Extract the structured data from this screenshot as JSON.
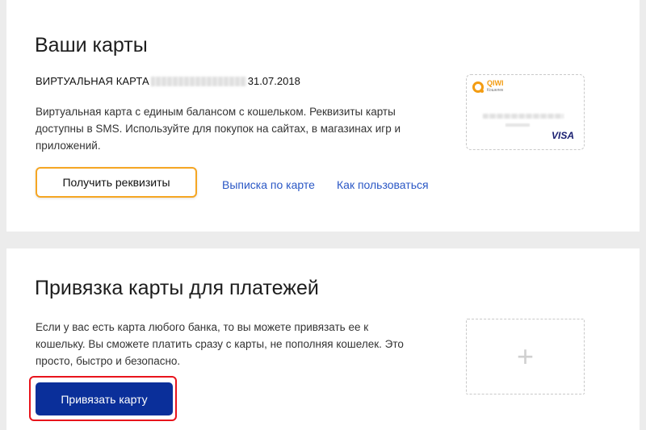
{
  "cards_section": {
    "title": "Ваши карты",
    "card_label": "ВИРТУАЛЬНАЯ КАРТА",
    "card_expiry": "31.07.2018",
    "description": "Виртуальная карта с единым балансом с кошельком. Реквизиты карты доступны в SMS. Используйте для покупок на сайтах, в магазинах игр и приложений.",
    "get_details_button": "Получить реквизиты",
    "statement_link": "Выписка по карте",
    "howto_link": "Как пользоваться",
    "card_image": {
      "brand_logo": "QIWI",
      "brand_sub": "Кошелек",
      "network": "VISA"
    }
  },
  "link_section": {
    "title": "Привязка карты для платежей",
    "description": "Если у вас есть карта любого банка, то вы можете привязать ее к кошельку. Вы сможете платить сразу с карты, не пополняя кошелек. Это просто, быстро и безопасно.",
    "add_card_symbol": "+",
    "link_card_button": "Привязать карту"
  },
  "colors": {
    "accent_orange": "#f5a623",
    "primary_blue": "#0a2f9a",
    "link_blue": "#2a57c5",
    "highlight_red": "#e8141c"
  }
}
